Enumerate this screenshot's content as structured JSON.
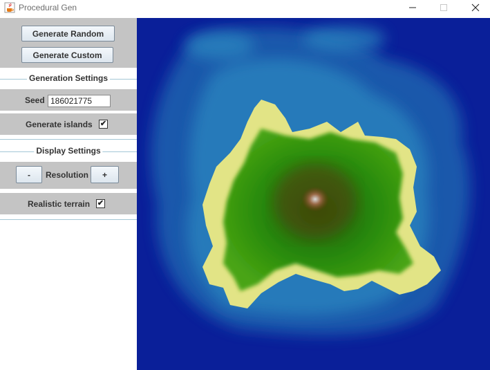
{
  "window": {
    "title": "Procedural Gen",
    "app_icon": "java-cup-icon",
    "controls": [
      "minimize-icon",
      "maximize-icon",
      "close-icon"
    ]
  },
  "sidebar": {
    "generate_random_label": "Generate Random",
    "generate_custom_label": "Generate Custom",
    "generation_settings": {
      "title": "Generation Settings",
      "seed_label": "Seed",
      "seed_value": "186021775",
      "islands_label": "Generate islands",
      "islands_checked": true,
      "check_glyph": "✔"
    },
    "display_settings": {
      "title": "Display Settings",
      "decrease_label": "-",
      "resolution_label": "Resolution",
      "increase_label": "+",
      "realistic_label": "Realistic terrain",
      "realistic_checked": true
    }
  },
  "map": {
    "colors": {
      "deep_water": "#0a1f99",
      "shallow_water": "#1f74b8",
      "sand": "#e2e486",
      "grass": "#2a8c0a",
      "forest": "#1e6a06",
      "mountain": "#6b3a10",
      "peak": "#bdbdbd"
    }
  }
}
